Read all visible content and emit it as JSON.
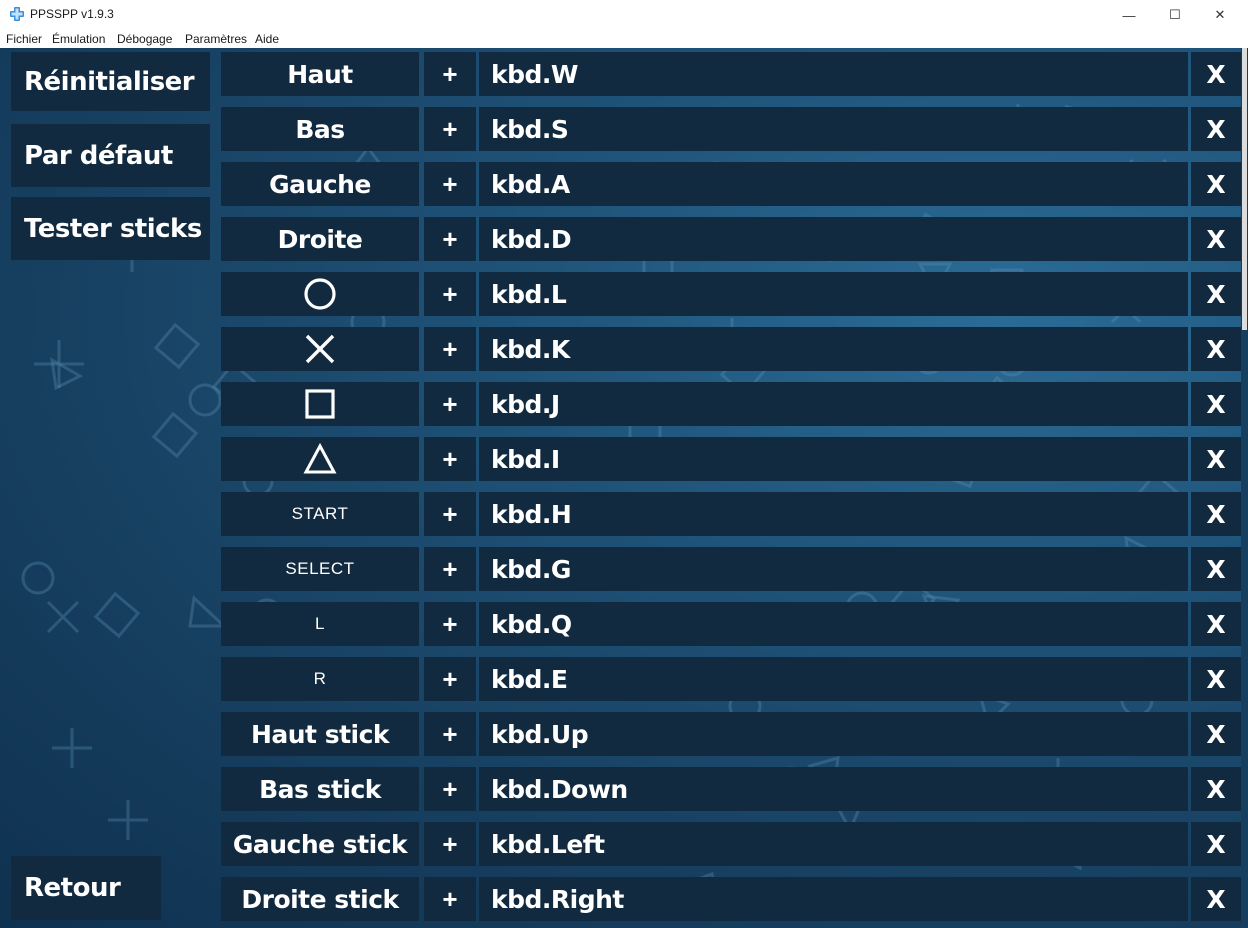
{
  "window": {
    "title": "PPSSPP v1.9.3",
    "minimize_glyph": "—",
    "maximize_glyph": "☐",
    "close_glyph": "✕"
  },
  "menu": [
    "Fichier",
    "Émulation",
    "Débogage",
    "Paramètres",
    "Aide"
  ],
  "sidebar": {
    "reset_label": "Réinitialiser",
    "default_label": "Par défaut",
    "test_sticks_label": "Tester sticks",
    "back_label": "Retour"
  },
  "mappings": [
    {
      "name": "Haut",
      "icon": null,
      "plus": "+",
      "key": "kbd.W",
      "remove": "X"
    },
    {
      "name": "Bas",
      "icon": null,
      "plus": "+",
      "key": "kbd.S",
      "remove": "X"
    },
    {
      "name": "Gauche",
      "icon": null,
      "plus": "+",
      "key": "kbd.A",
      "remove": "X"
    },
    {
      "name": "Droite",
      "icon": null,
      "plus": "+",
      "key": "kbd.D",
      "remove": "X"
    },
    {
      "name": "",
      "icon": "circle-icon",
      "plus": "+",
      "key": "kbd.L",
      "remove": "X"
    },
    {
      "name": "",
      "icon": "cross-icon",
      "plus": "+",
      "key": "kbd.K",
      "remove": "X"
    },
    {
      "name": "",
      "icon": "square-icon",
      "plus": "+",
      "key": "kbd.J",
      "remove": "X"
    },
    {
      "name": "",
      "icon": "triangle-icon",
      "plus": "+",
      "key": "kbd.I",
      "remove": "X"
    },
    {
      "name": "START",
      "icon": null,
      "plus": "+",
      "key": "kbd.H",
      "remove": "X"
    },
    {
      "name": "SELECT",
      "icon": null,
      "plus": "+",
      "key": "kbd.G",
      "remove": "X"
    },
    {
      "name": "L",
      "icon": null,
      "plus": "+",
      "key": "kbd.Q",
      "remove": "X"
    },
    {
      "name": "R",
      "icon": null,
      "plus": "+",
      "key": "kbd.E",
      "remove": "X"
    },
    {
      "name": "Haut stick",
      "icon": null,
      "plus": "+",
      "key": "kbd.Up",
      "remove": "X"
    },
    {
      "name": "Bas stick",
      "icon": null,
      "plus": "+",
      "key": "kbd.Down",
      "remove": "X"
    },
    {
      "name": "Gauche stick",
      "icon": null,
      "plus": "+",
      "key": "kbd.Left",
      "remove": "X"
    },
    {
      "name": "Droite stick",
      "icon": null,
      "plus": "+",
      "key": "kbd.Right",
      "remove": "X"
    }
  ],
  "colors": {
    "panel": "#122a3f",
    "background": "#1f5278",
    "text": "#ffffff"
  }
}
